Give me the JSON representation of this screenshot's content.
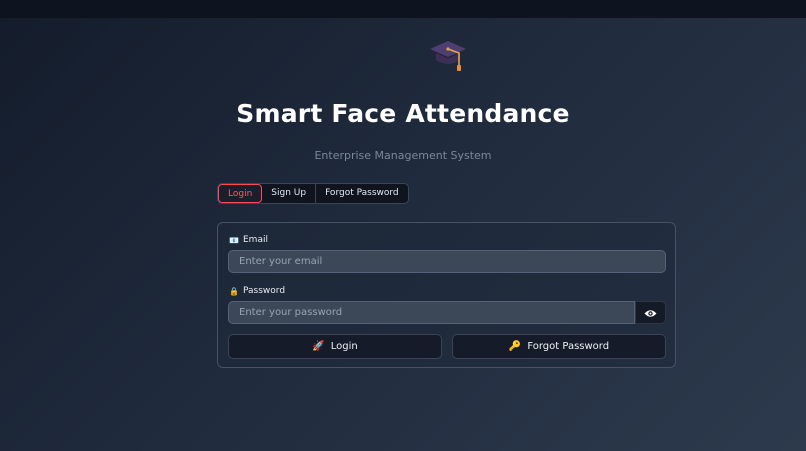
{
  "app": {
    "title": "Smart Face Attendance",
    "subtitle": "Enterprise Management System",
    "logo_icon": "graduation-cap-icon"
  },
  "tabs": [
    {
      "label": "Login",
      "active": true
    },
    {
      "label": "Sign Up",
      "active": false
    },
    {
      "label": "Forgot Password",
      "active": false
    }
  ],
  "form": {
    "email": {
      "icon": "envelope-icon",
      "icon_glyph": "📧",
      "label": "Email",
      "placeholder": "Enter your email",
      "value": ""
    },
    "password": {
      "icon": "lock-icon",
      "icon_glyph": "🔒",
      "label": "Password",
      "placeholder": "Enter your password",
      "value": ""
    },
    "show_password_icon": "eye-icon",
    "login_button": {
      "icon": "rocket-icon",
      "icon_glyph": "🚀",
      "label": "Login"
    },
    "forgot_button": {
      "icon": "key-icon",
      "icon_glyph": "🔑",
      "label": "Forgot Password"
    }
  },
  "colors": {
    "accent": "#ff4b55",
    "background_start": "#141c2b",
    "background_end": "#2d3a4d",
    "card_border": "#465266",
    "input_bg": "#3c4758"
  }
}
